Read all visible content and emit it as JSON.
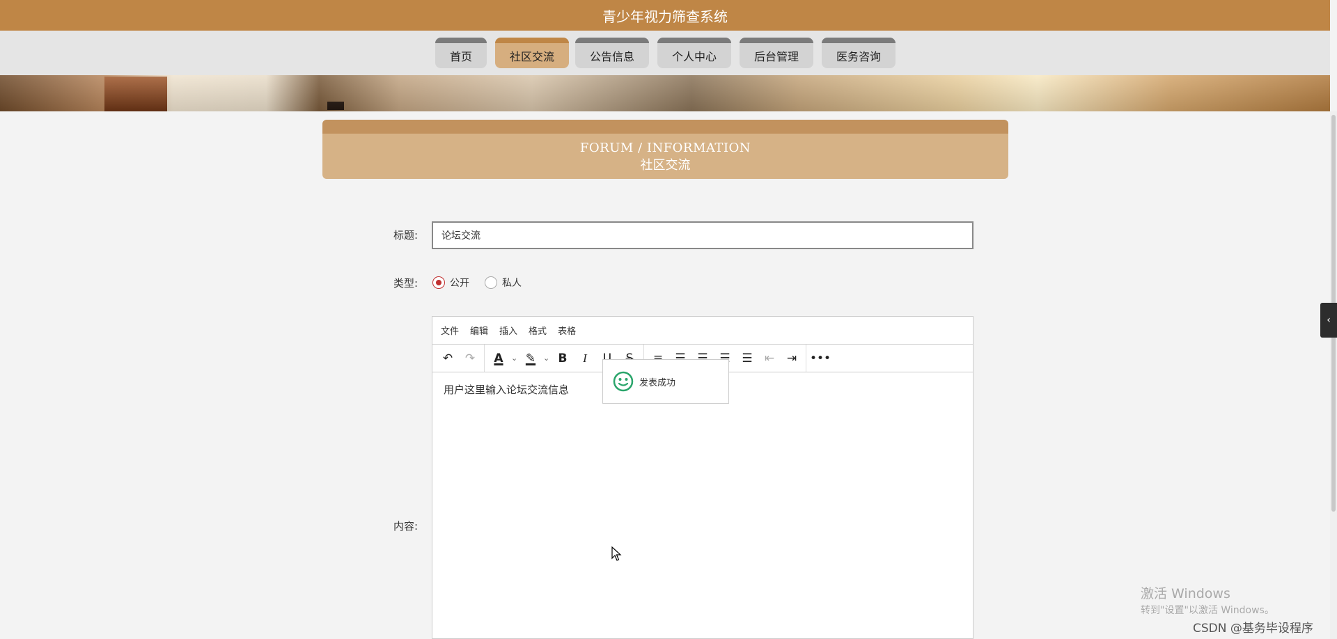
{
  "app": {
    "title": "青少年视力筛查系统"
  },
  "nav": {
    "tabs": [
      {
        "label": "首页",
        "active": false
      },
      {
        "label": "社区交流",
        "active": true
      },
      {
        "label": "公告信息",
        "active": false
      },
      {
        "label": "个人中心",
        "active": false
      },
      {
        "label": "后台管理",
        "active": false
      },
      {
        "label": "医务咨询",
        "active": false
      }
    ]
  },
  "section": {
    "title_en": "FORUM / INFORMATION",
    "title_cn": "社区交流"
  },
  "form": {
    "title_label": "标题:",
    "title_value": "论坛交流",
    "type_label": "类型:",
    "type_options": [
      {
        "label": "公开",
        "checked": true
      },
      {
        "label": "私人",
        "checked": false
      }
    ],
    "content_label": "内容:"
  },
  "editor": {
    "menus": [
      "文件",
      "编辑",
      "插入",
      "格式",
      "表格"
    ],
    "toolbar": [
      "undo-icon",
      "redo-icon",
      "text-color-icon",
      "highlight-icon",
      "bold-icon",
      "italic-icon",
      "underline-icon",
      "strikethrough-icon",
      "bullet-list-icon",
      "align-left-icon",
      "align-center-icon",
      "align-right-icon",
      "align-justify-icon",
      "outdent-icon",
      "indent-icon",
      "more-icon"
    ],
    "content_text": "用户这里输入论坛交流信息"
  },
  "toast": {
    "message": "发表成功",
    "icon": "smiley-icon",
    "color": "#2aa56b"
  },
  "watermark": {
    "line1": "激活 Windows",
    "line2": "转到\"设置\"以激活 Windows。",
    "source": "CSDN @基务毕设程序"
  },
  "colors": {
    "brand": "#bf8646",
    "tab_active": "#d6ae7f",
    "tab_inactive": "#d3d3d3",
    "header": "#d6b286",
    "radio": "#c03030"
  }
}
